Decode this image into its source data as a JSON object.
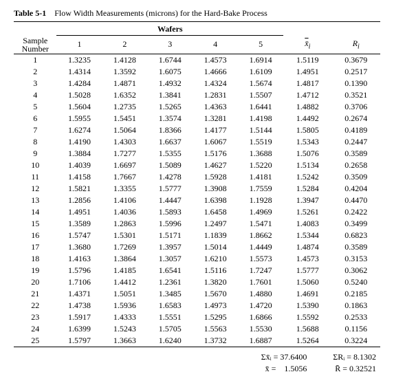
{
  "title": {
    "label": "Table 5-1",
    "caption": "Flow Width Measurements (microns) for the Hard-Bake Process"
  },
  "headers": {
    "group": "Wafers",
    "sample_top": "Sample",
    "sample_bot": "Number",
    "cols": [
      "1",
      "2",
      "3",
      "4",
      "5"
    ],
    "xbar": "x̄",
    "xbar_sub": "i",
    "r": "R",
    "r_sub": "i"
  },
  "chart_data": {
    "type": "table",
    "columns": [
      "Sample Number",
      "1",
      "2",
      "3",
      "4",
      "5",
      "x̄_i",
      "R_i"
    ],
    "rows": [
      [
        "1",
        "1.3235",
        "1.4128",
        "1.6744",
        "1.4573",
        "1.6914",
        "1.5119",
        "0.3679"
      ],
      [
        "2",
        "1.4314",
        "1.3592",
        "1.6075",
        "1.4666",
        "1.6109",
        "1.4951",
        "0.2517"
      ],
      [
        "3",
        "1.4284",
        "1.4871",
        "1.4932",
        "1.4324",
        "1.5674",
        "1.4817",
        "0.1390"
      ],
      [
        "4",
        "1.5028",
        "1.6352",
        "1.3841",
        "1.2831",
        "1.5507",
        "1.4712",
        "0.3521"
      ],
      [
        "5",
        "1.5604",
        "1.2735",
        "1.5265",
        "1.4363",
        "1.6441",
        "1.4882",
        "0.3706"
      ],
      [
        "6",
        "1.5955",
        "1.5451",
        "1.3574",
        "1.3281",
        "1.4198",
        "1.4492",
        "0.2674"
      ],
      [
        "7",
        "1.6274",
        "1.5064",
        "1.8366",
        "1.4177",
        "1.5144",
        "1.5805",
        "0.4189"
      ],
      [
        "8",
        "1.4190",
        "1.4303",
        "1.6637",
        "1.6067",
        "1.5519",
        "1.5343",
        "0.2447"
      ],
      [
        "9",
        "1.3884",
        "1.7277",
        "1.5355",
        "1.5176",
        "1.3688",
        "1.5076",
        "0.3589"
      ],
      [
        "10",
        "1.4039",
        "1.6697",
        "1.5089",
        "1.4627",
        "1.5220",
        "1.5134",
        "0.2658"
      ],
      [
        "11",
        "1.4158",
        "1.7667",
        "1.4278",
        "1.5928",
        "1.4181",
        "1.5242",
        "0.3509"
      ],
      [
        "12",
        "1.5821",
        "1.3355",
        "1.5777",
        "1.3908",
        "1.7559",
        "1.5284",
        "0.4204"
      ],
      [
        "13",
        "1.2856",
        "1.4106",
        "1.4447",
        "1.6398",
        "1.1928",
        "1.3947",
        "0.4470"
      ],
      [
        "14",
        "1.4951",
        "1.4036",
        "1.5893",
        "1.6458",
        "1.4969",
        "1.5261",
        "0.2422"
      ],
      [
        "15",
        "1.3589",
        "1.2863",
        "1.5996",
        "1.2497",
        "1.5471",
        "1.4083",
        "0.3499"
      ],
      [
        "16",
        "1.5747",
        "1.5301",
        "1.5171",
        "1.1839",
        "1.8662",
        "1.5344",
        "0.6823"
      ],
      [
        "17",
        "1.3680",
        "1.7269",
        "1.3957",
        "1.5014",
        "1.4449",
        "1.4874",
        "0.3589"
      ],
      [
        "18",
        "1.4163",
        "1.3864",
        "1.3057",
        "1.6210",
        "1.5573",
        "1.4573",
        "0.3153"
      ],
      [
        "19",
        "1.5796",
        "1.4185",
        "1.6541",
        "1.5116",
        "1.7247",
        "1.5777",
        "0.3062"
      ],
      [
        "20",
        "1.7106",
        "1.4412",
        "1.2361",
        "1.3820",
        "1.7601",
        "1.5060",
        "0.5240"
      ],
      [
        "21",
        "1.4371",
        "1.5051",
        "1.3485",
        "1.5670",
        "1.4880",
        "1.4691",
        "0.2185"
      ],
      [
        "22",
        "1.4738",
        "1.5936",
        "1.6583",
        "1.4973",
        "1.4720",
        "1.5390",
        "0.1863"
      ],
      [
        "23",
        "1.5917",
        "1.4333",
        "1.5551",
        "1.5295",
        "1.6866",
        "1.5592",
        "0.2533"
      ],
      [
        "24",
        "1.6399",
        "1.5243",
        "1.5705",
        "1.5563",
        "1.5530",
        "1.5688",
        "0.1156"
      ],
      [
        "25",
        "1.5797",
        "1.3663",
        "1.6240",
        "1.3732",
        "1.6887",
        "1.5264",
        "0.3224"
      ]
    ]
  },
  "summary": {
    "sum_xbar_label": "Σx̄ᵢ =",
    "sum_xbar": "37.6400",
    "sum_r_label": "ΣRᵢ =",
    "sum_r": "8.1302",
    "xbarbar_label": "x̄̄ =",
    "xbarbar": "1.5056",
    "rbar_label": "R̄ =",
    "rbar": "0.32521"
  }
}
